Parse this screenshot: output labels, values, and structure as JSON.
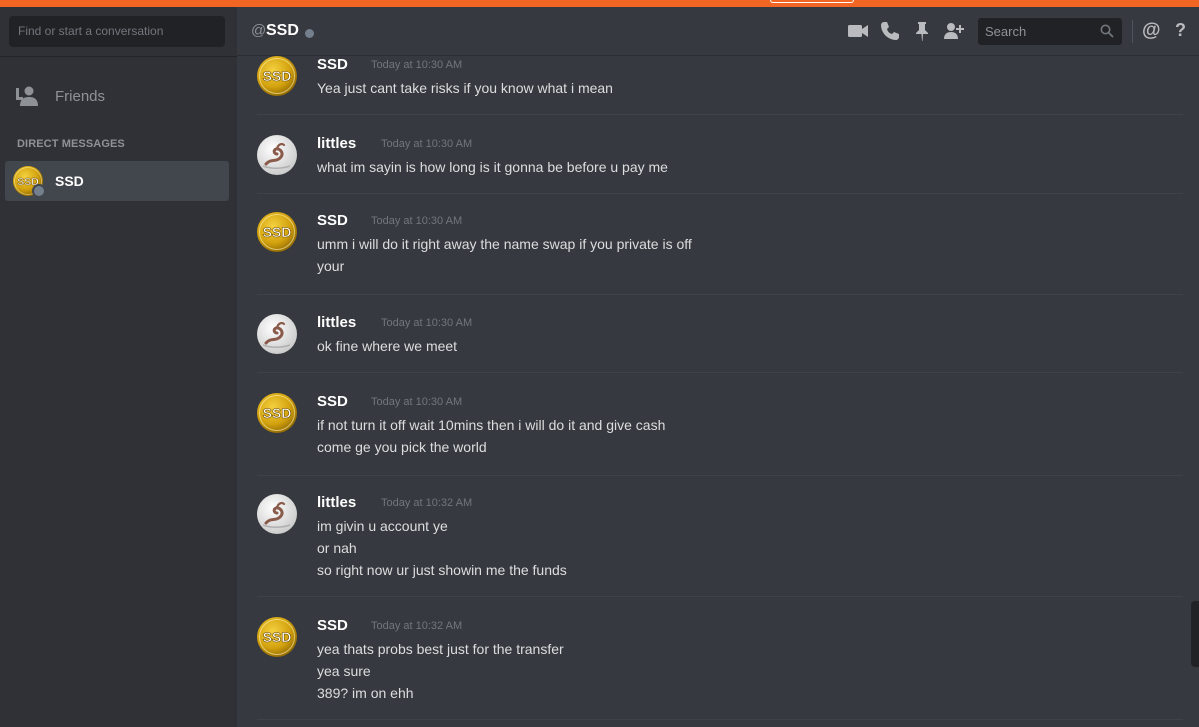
{
  "window": {
    "accent_color": "#f26522"
  },
  "sidebar": {
    "search_placeholder": "Find or start a conversation",
    "friends_label": "Friends",
    "friends_icon": "friends-icon",
    "dm_header": "DIRECT MESSAGES",
    "dm_items": [
      {
        "name": "SSD",
        "avatar_text": "SSD",
        "status": "offline"
      }
    ]
  },
  "header": {
    "at_symbol": "@",
    "channel_name": "SSD",
    "status": "offline",
    "icons": [
      "video-call-icon",
      "voice-call-icon",
      "pin-icon",
      "add-friend-icon",
      "mention-icon",
      "help-icon"
    ],
    "search_placeholder": "Search",
    "mention_glyph": "@",
    "help_glyph": "?"
  },
  "avatars": {
    "SSD": {
      "text": "SSD",
      "color": "#d4a30f"
    },
    "littles": {
      "icon": "littles-avatar-icon"
    }
  },
  "messages": [
    {
      "author": "SSD",
      "timestamp": "Today at 10:30 AM",
      "lines": [
        "Yea just cant take risks if you know what i mean"
      ]
    },
    {
      "author": "littles",
      "timestamp": "Today at 10:30 AM",
      "lines": [
        "what im sayin is how long is it gonna be before u pay me"
      ]
    },
    {
      "author": "SSD",
      "timestamp": "Today at 10:30 AM",
      "lines": [
        "umm i will do it right away the name swap if you private is off",
        "your"
      ]
    },
    {
      "author": "littles",
      "timestamp": "Today at 10:30 AM",
      "lines": [
        "ok fine where we meet"
      ]
    },
    {
      "author": "SSD",
      "timestamp": "Today at 10:30 AM",
      "lines": [
        "if not turn it off wait 10mins then i will do it and give cash",
        "come ge you pick the world"
      ]
    },
    {
      "author": "littles",
      "timestamp": "Today at 10:32 AM",
      "lines": [
        "im givin u account ye",
        "or nah",
        "so right now ur just showin me the funds"
      ]
    },
    {
      "author": "SSD",
      "timestamp": "Today at 10:32 AM",
      "lines": [
        "yea thats probs best just for the transfer",
        "yea sure",
        "389? im on ehh"
      ]
    }
  ]
}
